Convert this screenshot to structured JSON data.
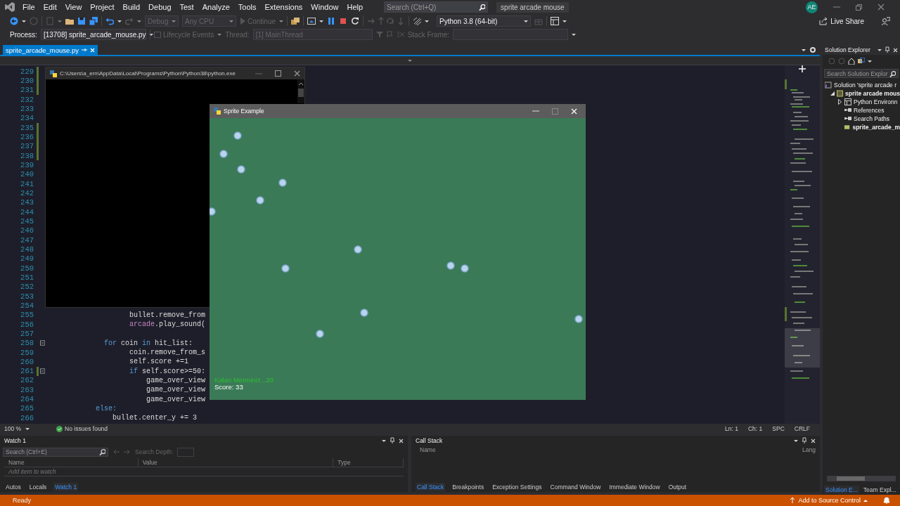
{
  "title_bar": {
    "menu": [
      "File",
      "Edit",
      "View",
      "Project",
      "Build",
      "Debug",
      "Test",
      "Analyze",
      "Tools",
      "Extensions",
      "Window",
      "Help"
    ],
    "search": {
      "placeholder": "Search (Ctrl+Q)"
    },
    "solution_name": "sprite arcade mouse",
    "account": "AE"
  },
  "toolbar": {
    "configuration": "Debug",
    "platform": "Any CPU",
    "continue": "Continue",
    "environment": "Python 3.8 (64-bit)",
    "live_share": "Live Share"
  },
  "debug_location": {
    "process_label": "Process:",
    "process": "[13708] sprite_arcade_mouse.py",
    "lifecycle": "Lifecycle Events",
    "thread_label": "Thread:",
    "thread": "[1] MainThread",
    "stack_frame_label": "Stack Frame:"
  },
  "editor": {
    "tabs": [
      {
        "label": "sprite_arcade_mouse.py",
        "selected": true
      }
    ],
    "lines": [
      {
        "number": "229",
        "changed": true,
        "fold": false
      },
      {
        "number": "230",
        "changed": true,
        "fold": false
      },
      {
        "number": "231",
        "changed": true,
        "fold": false
      },
      {
        "number": "232",
        "changed": false,
        "fold": false
      },
      {
        "number": "233",
        "changed": false,
        "fold": false
      },
      {
        "number": "234",
        "changed": false,
        "fold": false
      },
      {
        "number": "235",
        "changed": true,
        "fold": false
      },
      {
        "number": "236",
        "changed": true,
        "fold": false
      },
      {
        "number": "237",
        "changed": true,
        "fold": false
      },
      {
        "number": "238",
        "changed": true,
        "fold": false
      },
      {
        "number": "239",
        "changed": false,
        "fold": false
      },
      {
        "number": "240",
        "changed": false,
        "fold": false
      },
      {
        "number": "241",
        "changed": false,
        "fold": false
      },
      {
        "number": "242",
        "changed": false,
        "fold": false
      },
      {
        "number": "243",
        "changed": false,
        "fold": false
      },
      {
        "number": "244",
        "changed": false,
        "fold": false
      },
      {
        "number": "245",
        "changed": false,
        "fold": false
      },
      {
        "number": "246",
        "changed": false,
        "fold": false
      },
      {
        "number": "247",
        "changed": false,
        "fold": false
      },
      {
        "number": "248",
        "changed": false,
        "fold": false
      },
      {
        "number": "249",
        "changed": false,
        "fold": false
      },
      {
        "number": "250",
        "changed": false,
        "fold": false
      },
      {
        "number": "251",
        "changed": false,
        "fold": false
      },
      {
        "number": "252",
        "changed": false,
        "fold": false
      },
      {
        "number": "253",
        "changed": false,
        "fold": false
      },
      {
        "number": "254",
        "changed": false,
        "fold": false
      },
      {
        "number": "255",
        "changed": false,
        "fold": false,
        "code": [
          {
            "kind": "plain",
            "text": "                    bullet.remove_from"
          }
        ]
      },
      {
        "number": "256",
        "changed": false,
        "fold": false,
        "code": [
          {
            "kind": "module",
            "text": "                    arcade"
          },
          {
            "kind": "plain",
            "text": ".play_sound("
          }
        ]
      },
      {
        "number": "257",
        "changed": false,
        "fold": false
      },
      {
        "number": "258",
        "changed": false,
        "fold": true,
        "code": [
          {
            "kind": "keyword",
            "text": "              for"
          },
          {
            "kind": "plain",
            "text": " coin "
          },
          {
            "kind": "keyword",
            "text": "in"
          },
          {
            "kind": "plain",
            "text": " hit_list:"
          }
        ]
      },
      {
        "number": "259",
        "changed": false,
        "fold": false,
        "code": [
          {
            "kind": "plain",
            "text": "                    coin.remove_from_s"
          }
        ]
      },
      {
        "number": "260",
        "changed": false,
        "fold": false,
        "code": [
          {
            "kind": "plain",
            "text": "                    self.score +=1"
          }
        ]
      },
      {
        "number": "261",
        "changed": true,
        "fold": true,
        "code": [
          {
            "kind": "keyword",
            "text": "                    if"
          },
          {
            "kind": "plain",
            "text": " self.score>=50:"
          }
        ]
      },
      {
        "number": "262",
        "changed": false,
        "fold": false,
        "code": [
          {
            "kind": "plain",
            "text": "                        game_over_view"
          }
        ]
      },
      {
        "number": "263",
        "changed": false,
        "fold": false,
        "code": [
          {
            "kind": "plain",
            "text": "                        game_over_view"
          }
        ]
      },
      {
        "number": "264",
        "changed": false,
        "fold": false,
        "code": [
          {
            "kind": "plain",
            "text": "                        game_over_view"
          }
        ]
      },
      {
        "number": "265",
        "changed": false,
        "fold": false,
        "code": [
          {
            "kind": "keyword",
            "text": "            else:"
          }
        ]
      },
      {
        "number": "266",
        "changed": false,
        "fold": false,
        "code": [
          {
            "kind": "plain",
            "text": "                bullet.center_y += 3"
          }
        ]
      }
    ],
    "zoom": "100 %",
    "issues": "No issues found",
    "position": [
      "Ln: 1",
      "Ch: 1",
      "SPC",
      "CRLF"
    ]
  },
  "console_window": {
    "title": "C:\\Users\\a_ern\\AppData\\Local\\Programs\\Python\\Python38\\python.exe"
  },
  "game_window": {
    "title": "Sprite Example",
    "hud": [
      {
        "kind": "ammo",
        "text": "Kalan Merminiz...20"
      },
      {
        "kind": "score",
        "text": "Score: 33"
      }
    ]
  },
  "watch_panel": {
    "title": "Watch 1",
    "search": {
      "placeholder": "Search (Ctrl+E)"
    },
    "depth_label": "Search Depth:",
    "columns": [
      "Name",
      "Value",
      "Type"
    ],
    "add_row": {
      "placeholder": "Add item to watch"
    },
    "tabs": [
      {
        "label": "Autos",
        "selected": false
      },
      {
        "label": "Locals",
        "selected": false
      },
      {
        "label": "Watch 1",
        "selected": true
      }
    ]
  },
  "call_stack_panel": {
    "title": "Call Stack",
    "columns": [
      "Name",
      "Lang"
    ],
    "tabs": [
      {
        "label": "Call Stack",
        "selected": true
      },
      {
        "label": "Breakpoints",
        "selected": false
      },
      {
        "label": "Exception Settings",
        "selected": false
      },
      {
        "label": "Command Window",
        "selected": false
      },
      {
        "label": "Immediate Window",
        "selected": false
      },
      {
        "label": "Output",
        "selected": false
      }
    ]
  },
  "solution_explorer": {
    "title": "Solution Explorer",
    "search": {
      "placeholder": "Search Solution Explor"
    },
    "tree": [
      {
        "label": "Solution 'sprite arcade r",
        "kind": "solution",
        "children": [
          {
            "label": "sprite arcade mous",
            "kind": "project",
            "expanded": true,
            "children": [
              {
                "label": "Python Environn",
                "kind": "environments",
                "expanded": false
              },
              {
                "label": "References",
                "kind": "references"
              },
              {
                "label": "Search Paths",
                "kind": "paths"
              },
              {
                "label": "sprite_arcade_m",
                "kind": "file"
              }
            ]
          }
        ]
      }
    ],
    "tabs": [
      {
        "label": "Solution E...",
        "selected": true
      },
      {
        "label": "Team Expl...",
        "selected": false
      }
    ]
  },
  "status_bar": {
    "state": "Ready",
    "source_control": "Add to Source Control"
  }
}
